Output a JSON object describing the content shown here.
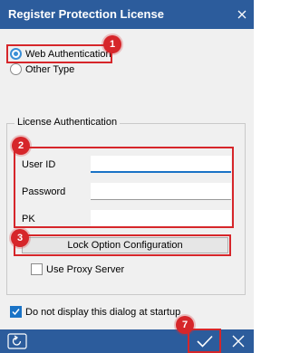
{
  "window": {
    "title": "Register Protection License"
  },
  "auth_type": {
    "options": [
      {
        "label": "Web Authentication",
        "selected": true
      },
      {
        "label": "Other Type",
        "selected": false
      }
    ]
  },
  "license_auth": {
    "group_title": "License Authentication",
    "fields": [
      {
        "label": "User ID",
        "value": ""
      },
      {
        "label": "Password",
        "value": ""
      },
      {
        "label": "PK",
        "value": ""
      }
    ],
    "lock_button_label": "Lock Option Configuration",
    "proxy_checkbox": {
      "label": "Use Proxy Server",
      "checked": false
    }
  },
  "startup_checkbox": {
    "label": "Do not display this dialog at startup",
    "checked": true
  },
  "annotations": {
    "steps": [
      "1",
      "2",
      "3",
      "7"
    ],
    "highlight_color": "#d6262a"
  },
  "colors": {
    "titlebar": "#2c5c9c",
    "accent": "#1a73c6",
    "background": "#f0f0f0"
  },
  "icons": {
    "close": "close-icon",
    "reset": "reset-icon",
    "confirm": "checkmark-icon",
    "cancel": "close-icon"
  }
}
